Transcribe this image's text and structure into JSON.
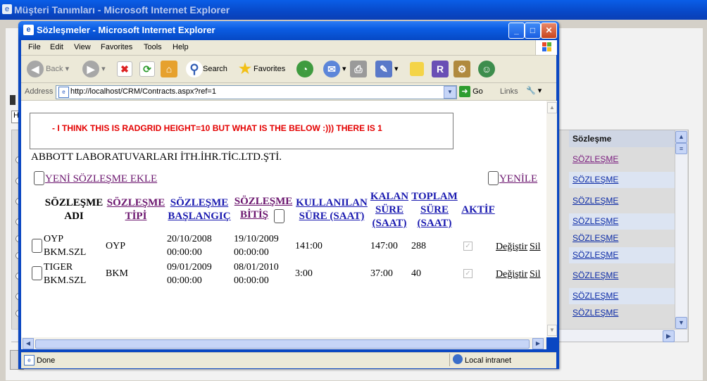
{
  "background_window": {
    "title": "Müşteri Tanımları - Microsoft Internet Explorer",
    "left_tab": "H",
    "grid": {
      "column_header": "Sözleşme",
      "rows": [
        "SÖZLEŞME",
        "SÖZLEŞME",
        "SÖZLEŞME",
        "SÖZLEŞME",
        "SÖZLEŞME",
        "SÖZLEŞME",
        "SÖZLEŞME",
        "SÖZLEŞME",
        "SÖZLEŞME"
      ]
    }
  },
  "popup": {
    "title": "Sözleşmeler - Microsoft Internet Explorer",
    "menu": [
      "File",
      "Edit",
      "View",
      "Favorites",
      "Tools",
      "Help"
    ],
    "toolbar": {
      "back": "Back",
      "search": "Search",
      "favorites": "Favorites"
    },
    "address": {
      "label": "Address",
      "url": "http://localhost/CRM/Contracts.aspx?ref=1",
      "go": "Go",
      "links": "Links"
    },
    "status": {
      "text": "Done",
      "zone": "Local intranet"
    }
  },
  "page": {
    "notice": "- I THINK THIS IS RADGRID HEIGHT=10 BUT WHAT IS THE BELOW :))) THERE IS 1",
    "company": "ABBOTT LABORATUVARLARI İTH.İHR.TİC.LTD.ŞTİ.",
    "add_link": "YENİ SÖZLEŞME EKLE",
    "refresh_link": "YENİLE",
    "columns": {
      "name_1": "SÖZLEŞME",
      "name_2": "ADI",
      "type_1": "SÖZLEŞME",
      "type_2": "TİPİ",
      "start_1": "SÖZLEŞME",
      "start_2": "BAŞLANGIÇ",
      "end_1": "SÖZLEŞME",
      "end_2": "BİTİŞ",
      "used_1": "KULLANILAN",
      "used_2": "SÜRE (SAAT)",
      "left_1": "KALAN",
      "left_2": "SÜRE",
      "left_3": "(SAAT)",
      "total_1": "TOPLAM",
      "total_2": "SÜRE",
      "total_3": "(SAAT)",
      "active": "AKTİF"
    },
    "rows": [
      {
        "name_1": "OYP",
        "name_2": "BKM.SZL",
        "type": "OYP",
        "start_1": "20/10/2008",
        "start_2": "00:00:00",
        "end_1": "19/10/2009",
        "end_2": "00:00:00",
        "used": "141:00",
        "left": "147:00",
        "total": "288",
        "active": true,
        "edit": "Değiştir",
        "delete": "Sil"
      },
      {
        "name_1": "TIGER",
        "name_2": "BKM.SZL",
        "type": "BKM",
        "start_1": "09/01/2009",
        "start_2": "00:00:00",
        "end_1": "08/01/2010",
        "end_2": "00:00:00",
        "used": "3:00",
        "left": "37:00",
        "total": "40",
        "active": true,
        "edit": "Değiştir",
        "delete": "Sil"
      }
    ]
  }
}
